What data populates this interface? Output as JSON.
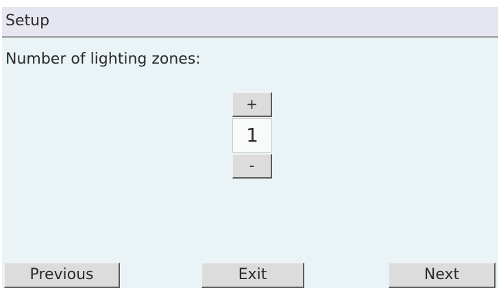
{
  "header": {
    "title": "Setup"
  },
  "main": {
    "prompt": "Number of lighting zones:",
    "stepper": {
      "increment_label": "+",
      "value": "1",
      "decrement_label": "-"
    }
  },
  "footer": {
    "previous_label": "Previous",
    "exit_label": "Exit",
    "next_label": "Next"
  }
}
